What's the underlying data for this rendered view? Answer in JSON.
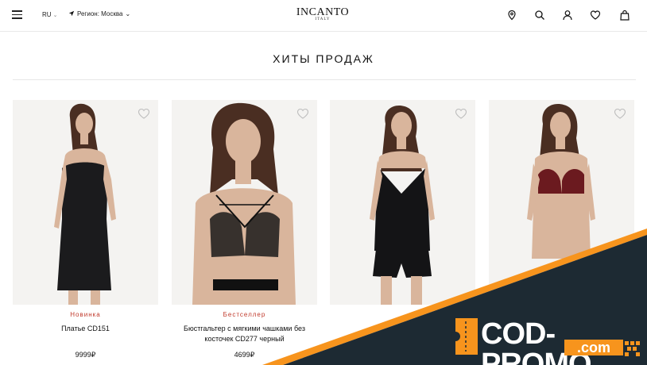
{
  "header": {
    "lang": "RU",
    "region": "Регион: Москва",
    "brand": "INCANTO",
    "brand_sub": "ITALY"
  },
  "section_title": "ХИТЫ ПРОДАЖ",
  "products": [
    {
      "badge": "Новинка",
      "name": "Платье CD151",
      "price": "9999₽"
    },
    {
      "badge": "Бестселлер",
      "name": "Бюстгальтер с мягкими чашками без косточек CD277 черный",
      "price": "4699₽"
    },
    {
      "badge": "",
      "name": "",
      "price": ""
    },
    {
      "badge": "",
      "name": "",
      "price": ""
    }
  ],
  "promo": {
    "text": "COD-PROMO",
    "domain": ".com",
    "colors": {
      "dark": "#1d2a33",
      "accent": "#f7941d"
    }
  },
  "icons": [
    "menu-icon",
    "chevron-down-icon",
    "location-arrow-icon",
    "map-pin-icon",
    "search-icon",
    "user-icon",
    "heart-icon",
    "bag-icon"
  ]
}
